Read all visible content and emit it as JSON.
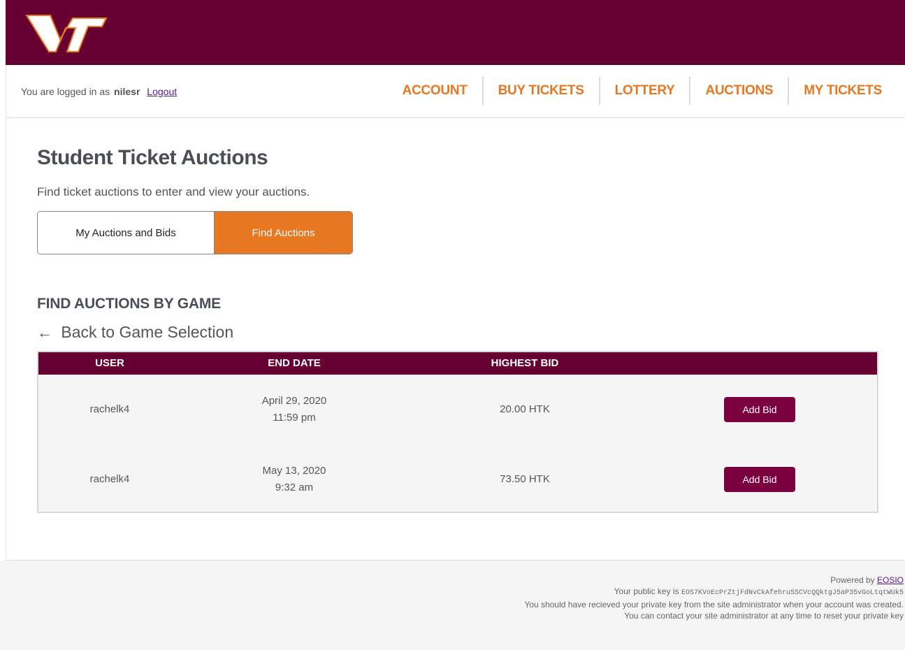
{
  "header": {
    "logo_text": "VT",
    "colors": {
      "brand": "#660033",
      "accent": "#e87722"
    }
  },
  "session": {
    "logged_in_prefix": "You are logged in as",
    "username": "nilesr",
    "logout_label": "Logout"
  },
  "nav": {
    "items": [
      {
        "label": "ACCOUNT"
      },
      {
        "label": "BUY TICKETS"
      },
      {
        "label": "LOTTERY"
      },
      {
        "label": "AUCTIONS"
      },
      {
        "label": "MY TICKETS"
      }
    ]
  },
  "main": {
    "title": "Student Ticket Auctions",
    "subtitle": "Find ticket auctions to enter and view your auctions.",
    "toggle": {
      "my_auctions_label": "My Auctions and Bids",
      "find_auctions_label": "Find Auctions",
      "selected": "Find Auctions"
    },
    "section_heading": "FIND AUCTIONS BY GAME",
    "back_icon": "left-arrow-icon",
    "back_label": "Back to Game Selection",
    "table": {
      "columns": [
        "USER",
        "END DATE",
        "HIGHEST BID",
        ""
      ],
      "rows": [
        {
          "user": "rachelk4",
          "end_date": "April 29, 2020",
          "end_time": "11:59 pm",
          "highest_bid": "20.00 HTK",
          "action": "Add Bid"
        },
        {
          "user": "rachelk4",
          "end_date": "May 13, 2020",
          "end_time": "9:32 am",
          "highest_bid": "73.50 HTK",
          "action": "Add Bid"
        }
      ]
    }
  },
  "footer": {
    "powered_by": "Powered by",
    "eosio_label": "EOSIO",
    "public_key_prefix": "Your public key is",
    "public_key": "EOS7KVoEcPrZtjFdNvCkAfehruSSCVcQQktgJ5aP35vGoLtqtWUk5",
    "private_key_note": "You should have recieved your private key from the site administrator when your account was created.",
    "contact_note": "You can contact your site administrator at any time to reset your private key"
  }
}
